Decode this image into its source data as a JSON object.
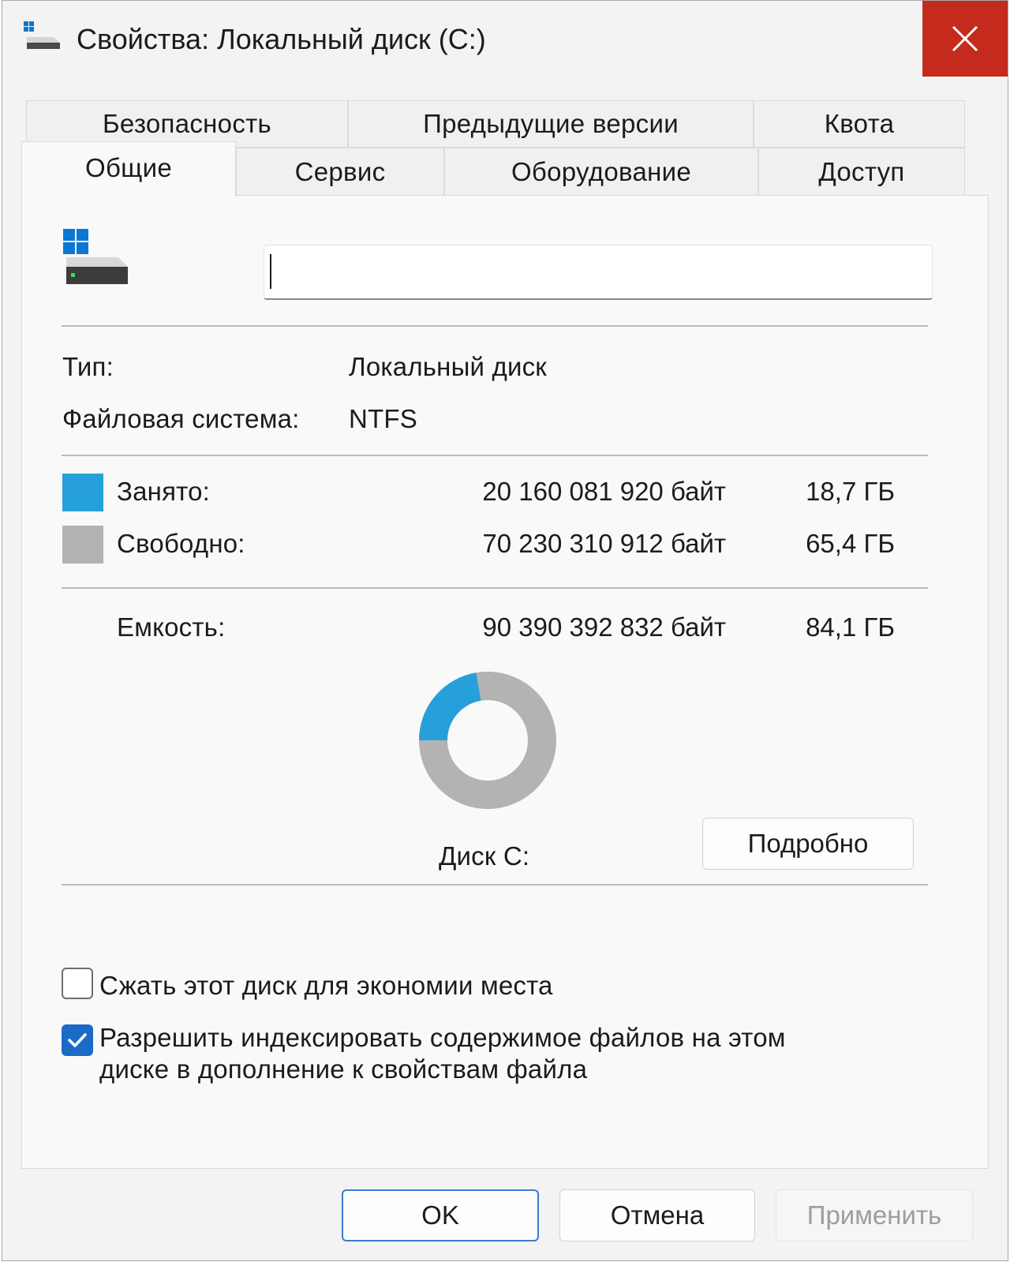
{
  "window": {
    "title": "Свойства: Локальный диск (C:)"
  },
  "tabs_top": [
    {
      "label": "Безопасность"
    },
    {
      "label": "Предыдущие версии"
    },
    {
      "label": "Квота"
    }
  ],
  "tabs_bottom": [
    {
      "label": "Общие",
      "active": true
    },
    {
      "label": "Сервис"
    },
    {
      "label": "Оборудование"
    },
    {
      "label": "Доступ"
    }
  ],
  "general": {
    "name_value": "",
    "type_label": "Тип:",
    "type_value": "Локальный диск",
    "fs_label": "Файловая система:",
    "fs_value": "NTFS",
    "used_label": "Занято:",
    "used_bytes": "20 160 081 920 байт",
    "used_gb": "18,7 ГБ",
    "free_label": "Свободно:",
    "free_bytes": "70 230 310 912 байт",
    "free_gb": "65,4 ГБ",
    "capacity_label": "Емкость:",
    "capacity_bytes": "90 390 392 832 байт",
    "capacity_gb": "84,1 ГБ",
    "disk_label": "Диск C:",
    "details_button": "Подробно",
    "used_color": "#26a0da",
    "free_color": "#b3b3b3",
    "used_fraction": 0.223
  },
  "options": {
    "compress_label": "Сжать этот диск для экономии места",
    "compress_checked": false,
    "index_label_line1": "Разрешить индексировать содержимое файлов на этом",
    "index_label_line2": "диске в дополнение к свойствам файла",
    "index_checked": true
  },
  "buttons": {
    "ok": "OK",
    "cancel": "Отмена",
    "apply": "Применить"
  }
}
